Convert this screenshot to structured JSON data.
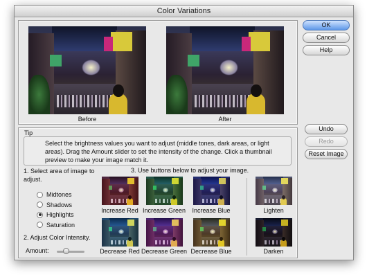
{
  "window": {
    "title": "Color Variations"
  },
  "preview": {
    "before_label": "Before",
    "after_label": "After"
  },
  "tip": {
    "heading": "Tip",
    "text": "Select the brightness values you want to adjust (middle tones, dark areas, or light areas). Drag the Amount slider to set the intensity of the change. Click a thumbnail preview to make your image match it."
  },
  "step1": {
    "label": "1. Select area of image to adjust.",
    "options": [
      {
        "label": "Midtones",
        "selected": false
      },
      {
        "label": "Shadows",
        "selected": false
      },
      {
        "label": "Highlights",
        "selected": true
      },
      {
        "label": "Saturation",
        "selected": false
      }
    ]
  },
  "step2": {
    "label": "2. Adjust Color Intensity.",
    "amount_label": "Amount:",
    "amount_level": 0.2
  },
  "step3": {
    "label": "3. Use buttons below to adjust your image.",
    "thumbnails": [
      {
        "label": "Increase Red",
        "tint": "#ff4040"
      },
      {
        "label": "Increase Green",
        "tint": "#40ff60"
      },
      {
        "label": "Increase Blue",
        "tint": "#4060ff"
      },
      {
        "label": "Lighten",
        "tint": "#ffffff"
      },
      {
        "label": "Decrease Red",
        "tint": "#40e0ff"
      },
      {
        "label": "Decrease Green",
        "tint": "#ff40ff"
      },
      {
        "label": "Decrease Blue",
        "tint": "#ffe040"
      },
      {
        "label": "Darken",
        "tint": "#000000"
      }
    ]
  },
  "buttons": {
    "ok": "OK",
    "cancel": "Cancel",
    "help": "Help",
    "undo": "Undo",
    "redo": "Redo",
    "reset": "Reset Image"
  },
  "colors": {
    "accent": "#5e97e8",
    "window_bg": "#e8e8e8"
  }
}
